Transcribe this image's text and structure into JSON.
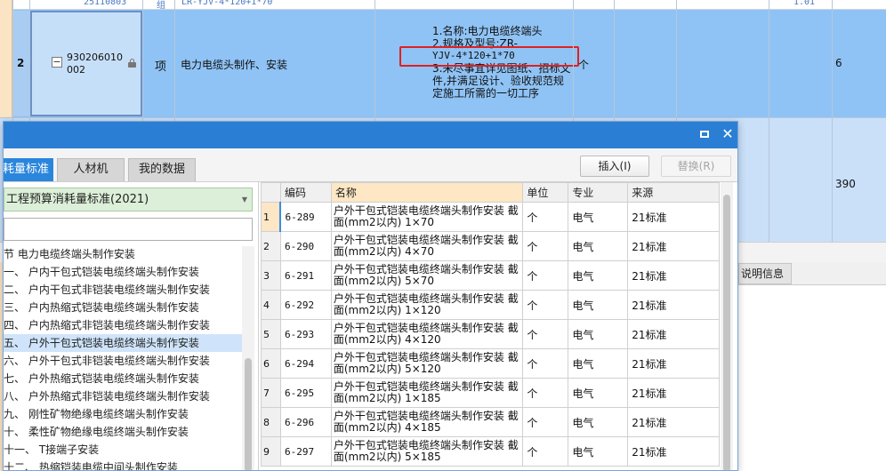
{
  "sheet": {
    "top_row_code": "25110803",
    "top_row_unit": "组",
    "top_row_spec": "LR-YJV-4*120+1*70",
    "top_row_qty": "1.01",
    "row2": {
      "row_number": "2",
      "code": "930206010002",
      "type": "项",
      "name": "电力电缆头制作、安装",
      "desc_lines": [
        "1.名称:电力电缆终端头",
        "2.规格及型号:ZR-",
        "YJV-4*120+1*70",
        "3.未尽事宜详见图纸、招标文",
        "件,并满足设计、验收规范规",
        "定施工所需的一切工序"
      ],
      "unit": "个",
      "qty": "6"
    },
    "row3_qty": "390",
    "explain_tab": "说明信息"
  },
  "dialog": {
    "tabs": [
      "耗量标准",
      "人材机",
      "我的数据"
    ],
    "insert_button": "插入(I)",
    "replace_button": "替换(R)",
    "standard_select": "工程预算消耗量标准(2021)",
    "filter_placeholder": "",
    "tree": [
      "节 电力电缆终端头制作安装",
      "一、 户内干包式铠装电缆终端头制作安装",
      "二、 户内干包式非铠装电缆终端头制作安装",
      "三、 户内热缩式铠装电缆终端头制作安装",
      "四、 户内热缩式非铠装电缆终端头制作安装",
      "五、 户外干包式铠装电缆终端头制作安装",
      "六、 户外干包式非铠装电缆终端头制作安装",
      "七、 户外热缩式铠装电缆终端头制作安装",
      "八、 户外热缩式非铠装电缆终端头制作安装",
      "九、 刚性矿物绝缘电缆终端头制作安装",
      "十、 柔性矿物绝缘电缆终端头制作安装",
      "十一、 T接端子安装",
      "十二、 热缩铠装电缆中间头制作安装"
    ],
    "tree_selected_index": 5,
    "columns": [
      "",
      "编码",
      "名称",
      "单位",
      "专业",
      "来源"
    ],
    "rows": [
      {
        "n": "1",
        "code": "6-289",
        "name1": "户外干包式铠装电缆终端头制作安装 截",
        "name2": "面(mm2以内) 1×70",
        "unit": "个",
        "major": "电气",
        "source": "21标准"
      },
      {
        "n": "2",
        "code": "6-290",
        "name1": "户外干包式铠装电缆终端头制作安装 截",
        "name2": "面(mm2以内) 4×70",
        "unit": "个",
        "major": "电气",
        "source": "21标准"
      },
      {
        "n": "3",
        "code": "6-291",
        "name1": "户外干包式铠装电缆终端头制作安装 截",
        "name2": "面(mm2以内) 5×70",
        "unit": "个",
        "major": "电气",
        "source": "21标准"
      },
      {
        "n": "4",
        "code": "6-292",
        "name1": "户外干包式铠装电缆终端头制作安装 截",
        "name2": "面(mm2以内) 1×120",
        "unit": "个",
        "major": "电气",
        "source": "21标准"
      },
      {
        "n": "5",
        "code": "6-293",
        "name1": "户外干包式铠装电缆终端头制作安装 截",
        "name2": "面(mm2以内) 4×120",
        "unit": "个",
        "major": "电气",
        "source": "21标准"
      },
      {
        "n": "6",
        "code": "6-294",
        "name1": "户外干包式铠装电缆终端头制作安装 截",
        "name2": "面(mm2以内) 5×120",
        "unit": "个",
        "major": "电气",
        "source": "21标准"
      },
      {
        "n": "7",
        "code": "6-295",
        "name1": "户外干包式铠装电缆终端头制作安装 截",
        "name2": "面(mm2以内) 1×185",
        "unit": "个",
        "major": "电气",
        "source": "21标准"
      },
      {
        "n": "8",
        "code": "6-296",
        "name1": "户外干包式铠装电缆终端头制作安装 截",
        "name2": "面(mm2以内) 4×185",
        "unit": "个",
        "major": "电气",
        "source": "21标准"
      },
      {
        "n": "9",
        "code": "6-297",
        "name1": "户外干包式铠装电缆终端头制作安装 截",
        "name2": "面(mm2以内) 5×185",
        "unit": "个",
        "major": "电气",
        "source": "21标准"
      }
    ]
  }
}
